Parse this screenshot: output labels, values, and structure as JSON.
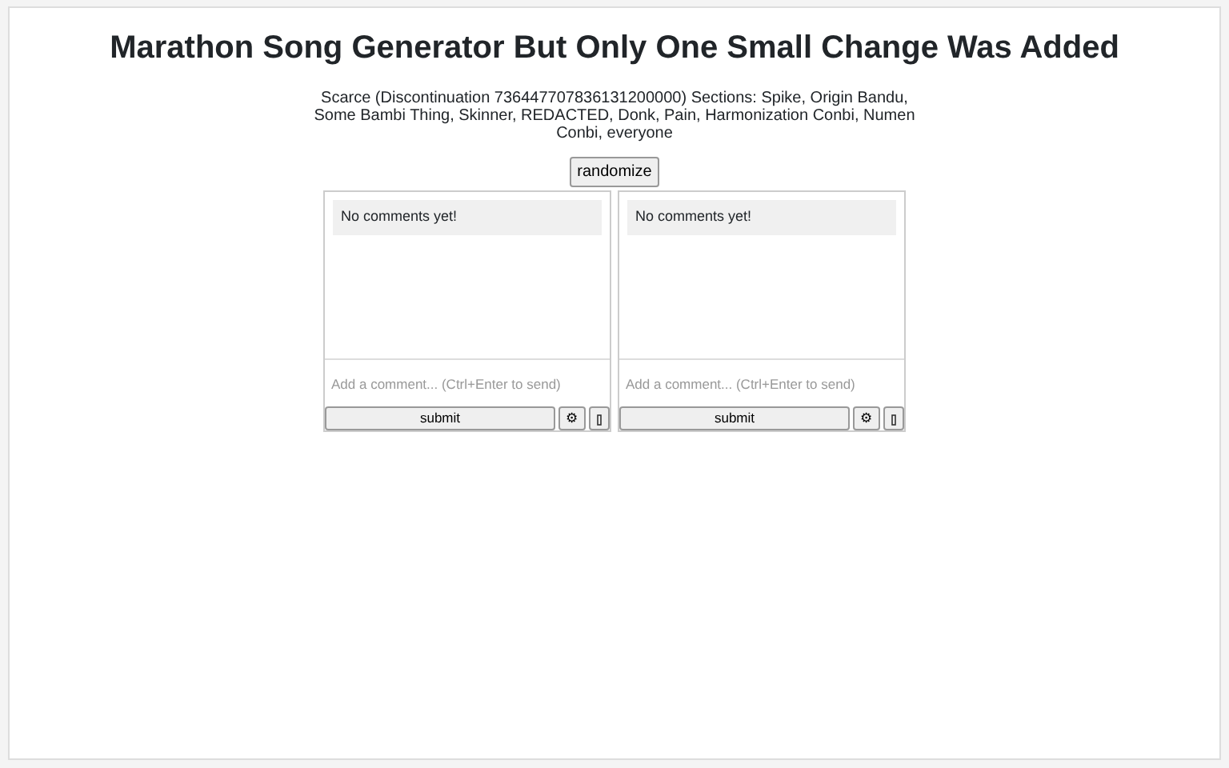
{
  "title": "Marathon Song Generator But Only One Small Change Was Added",
  "description": "Scarce (Discontinuation 736447707836131200000) Sections: Spike, Origin Bandu, Some Bambi Thing, Skinner, REDACTED, Donk, Pain, Harmonization Conbi, Numen Conbi, everyone",
  "randomize_button": "randomize",
  "comment_panels": [
    {
      "message": "No comments yet!",
      "placeholder": "Add a comment... (Ctrl+Enter to send)",
      "submit": "submit",
      "settings": "⚙"
    },
    {
      "message": "No comments yet!",
      "placeholder": "Add a comment... (Ctrl+Enter to send)",
      "submit": "submit",
      "settings": "⚙"
    }
  ]
}
